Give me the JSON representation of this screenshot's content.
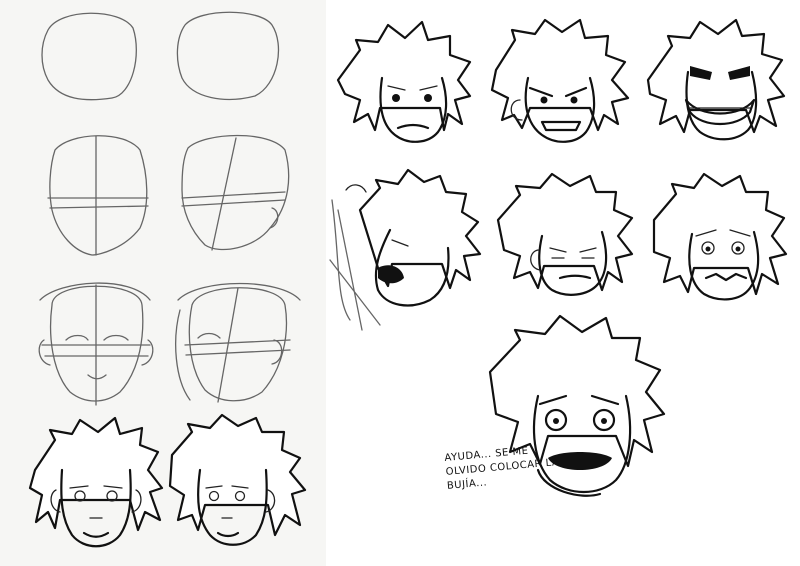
{
  "caption": {
    "line1": "AYUDA... SE ME",
    "line2": "OLVIDO COLOCAR LA",
    "line3": "BUJÍA..."
  },
  "colors": {
    "paper_left": "#f6f6f4",
    "paper_right": "#ffffff",
    "pencil": "#666666",
    "ink": "#111111"
  }
}
